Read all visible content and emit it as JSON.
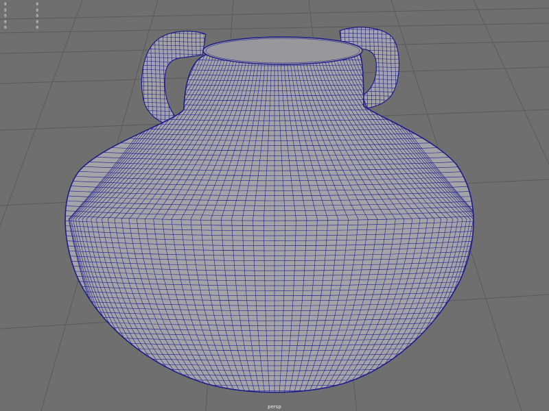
{
  "viewport": {
    "camera_label": "persp",
    "background_color": "#6f6f6f",
    "grid_color": "#5a5a5a",
    "wireframe_color": "#1c1c8a",
    "surface_color": "#a4a3a8"
  },
  "hud": {
    "rows": [
      {
        "key": "0",
        "value": "0"
      },
      {
        "key": "0",
        "value": "0"
      },
      {
        "key": "0",
        "value": "0"
      },
      {
        "key": "0",
        "value": "0"
      },
      {
        "key": "0",
        "value": "0"
      }
    ]
  },
  "scene": {
    "object": "jar-mesh"
  }
}
